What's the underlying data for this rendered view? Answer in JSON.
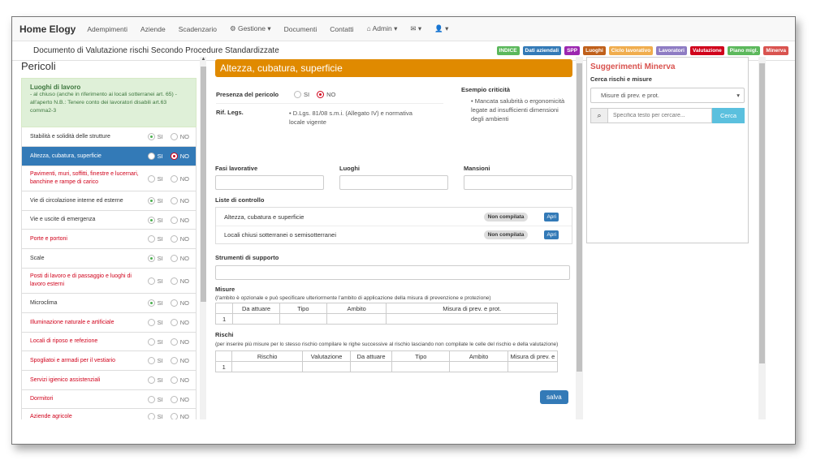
{
  "navbar": {
    "brand": "Home Elogy",
    "items": [
      "Adempimenti",
      "Aziende",
      "Scadenzario",
      "Gestione",
      "Documenti",
      "Contatti",
      "Admin"
    ]
  },
  "doc": {
    "title": "Documento di Valutazione rischi Secondo Procedure Standardizzate",
    "badges": [
      {
        "label": "INDICE",
        "color": "#5cb85c"
      },
      {
        "label": "Dati aziendali",
        "color": "#337ab7"
      },
      {
        "label": "SPP",
        "color": "#9c27b0"
      },
      {
        "label": "Luoghi",
        "color": "#c0601a"
      },
      {
        "label": "Ciclo lavorativo",
        "color": "#f0ad4e"
      },
      {
        "label": "Lavoratori",
        "color": "#8e7cc3"
      },
      {
        "label": "Valutazione",
        "color": "#d0021b"
      },
      {
        "label": "Piano migl.",
        "color": "#5cb85c"
      },
      {
        "label": "Minerva",
        "color": "#d9534f"
      }
    ]
  },
  "left": {
    "title": "Pericoli",
    "luoghi": {
      "title": "Luoghi di lavoro",
      "desc": "- al chiuso (anche in riferimento ai locali sotterranei art. 65) - all'aperto N.B.: Tenere conto dei lavoratori disabili art.63 comma2-3"
    },
    "si": "SI",
    "no": "NO",
    "items": [
      {
        "label": "Stabilità e solidità delle strutture",
        "state": "si",
        "red": false,
        "h": 24
      },
      {
        "label": "Altezza, cubatura, superficie",
        "state": "no",
        "red": false,
        "active": true,
        "h": 24
      },
      {
        "label": "Pavimenti, muri, soffitti, finestre e lucernari, banchine e rampe di carico",
        "state": "none",
        "red": true,
        "h": 31
      },
      {
        "label": "Vie di circolazione interne ed esterne",
        "state": "si",
        "red": false,
        "h": 24
      },
      {
        "label": "Vie e uscite di emergenza",
        "state": "si",
        "red": false,
        "h": 23
      },
      {
        "label": "Porte e portoni",
        "state": "none",
        "red": true,
        "h": 24
      },
      {
        "label": "Scale",
        "state": "si",
        "red": false,
        "h": 24
      },
      {
        "label": "Posti di lavoro e di passaggio e luoghi di lavoro esterni",
        "state": "none",
        "red": true,
        "h": 31
      },
      {
        "label": "Microclima",
        "state": "si",
        "red": false,
        "h": 24
      },
      {
        "label": "Illuminazione naturale e artificiale",
        "state": "none",
        "red": true,
        "h": 24
      },
      {
        "label": "Locali di riposo e refezione",
        "state": "none",
        "red": true,
        "h": 23
      },
      {
        "label": "Spogliatoi e armadi per il vestiario",
        "state": "none",
        "red": true,
        "h": 24
      },
      {
        "label": "Servizi igienico assistenziali",
        "state": "none",
        "red": true,
        "h": 24
      },
      {
        "label": "Dormitori",
        "state": "none",
        "red": true,
        "h": 23
      },
      {
        "label": "Aziende agricole",
        "state": "none",
        "red": true,
        "h": 20
      }
    ]
  },
  "main": {
    "title": "Altezza, cubatura, superficie",
    "presenza_label": "Presenza del pericolo",
    "si": "SI",
    "no": "NO",
    "rif_label": "Rif. Legs.",
    "rif_text": "D.Lgs. 81/08 s.m.i. (Allegato IV) e normativa locale vigente",
    "esempio_label": "Esempio criticità",
    "esempio_text": "Mancata salubrità o ergonomicità legate ad insufficienti dimensioni degli ambienti",
    "fasi": "Fasi lavorative",
    "luoghi": "Luoghi",
    "mansioni": "Mansioni",
    "liste_label": "Liste di controllo",
    "liste": [
      {
        "label": "Altezza, cubatura e superficie",
        "status": "Non compilata",
        "btn": "Apri"
      },
      {
        "label": "Locali chiusi sotterranei o semisotterranei",
        "status": "Non compilata",
        "btn": "Apri"
      }
    ],
    "strumenti": "Strumenti di supporto",
    "misure_label": "Misure",
    "misure_note": "(l'ambito è opzionale e può specificare ulteriormente l'ambito di applicazione della misura di prevenzione e protezione)",
    "misure_cols": [
      "Da attuare",
      "Tipo",
      "Ambito",
      "Misura di prev. e prot."
    ],
    "rischi_label": "Rischi",
    "rischi_note": "(per inserire più misure per lo stesso rischio compilare le righe successive al rischio lasciando non compilate le celle del rischio e della valutazione)",
    "rischi_cols": [
      "Rischio",
      "Valutazione",
      "Da attuare",
      "Tipo",
      "Ambito",
      "Misura di prev. e"
    ],
    "row_num": "1",
    "salva": "salva"
  },
  "right": {
    "title": "Suggerimenti Minerva",
    "cerca_label": "Cerca rischi e misure",
    "select_value": "Misure di prev. e prot.",
    "search_placeholder": "Specifica testo per cercare...",
    "cerca_btn": "Cerca"
  }
}
